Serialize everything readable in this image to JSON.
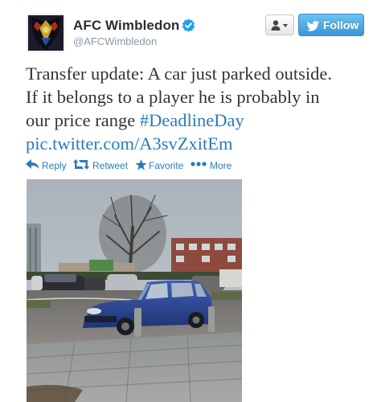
{
  "user": {
    "name": "AFC Wimbledon",
    "handle": "@AFCWimbledon"
  },
  "follow_button": {
    "label": "Follow"
  },
  "tweet": {
    "line1": "Transfer update: A car just parked outside.",
    "line2": "If it belongs to a player he is probably in",
    "line3_text": "our price range ",
    "hashtag": "#DeadlineDay",
    "link": "pic.twitter.com/A3svZxitEm"
  },
  "actions": {
    "reply": "Reply",
    "retweet": "Retweet",
    "favorite": "Favorite",
    "more": "More"
  },
  "colors": {
    "link": "#2b7bb9",
    "follow_button": "#3a95d4",
    "verified": "#1da1f2"
  },
  "icons": {
    "verified": "verified-badge-icon",
    "user_menu": "user-dropdown-icon",
    "follow": "twitter-bird-icon",
    "reply": "reply-arrow-icon",
    "retweet": "retweet-icon",
    "favorite": "star-icon",
    "more": "ellipsis-icon"
  }
}
